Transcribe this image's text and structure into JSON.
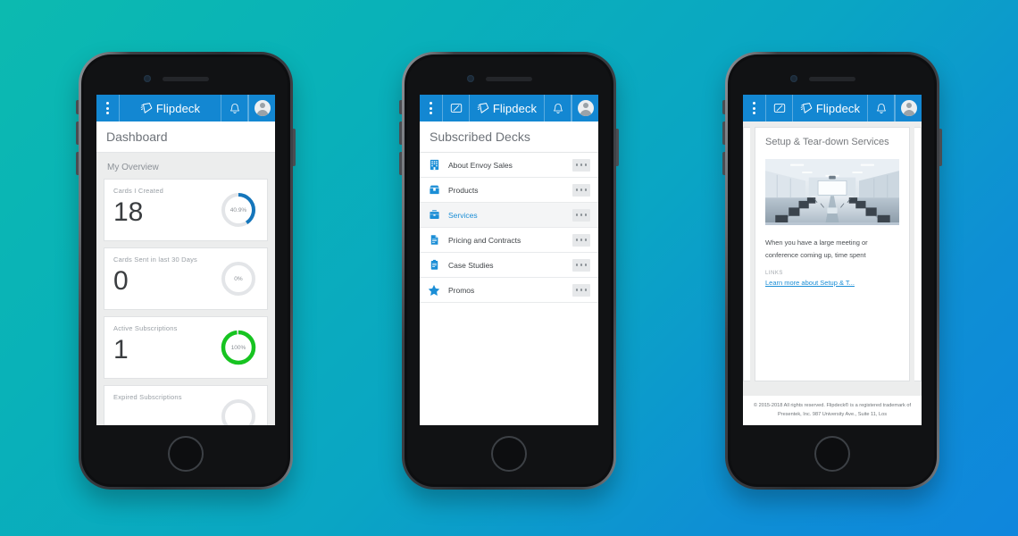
{
  "background": {
    "from": "#0cbab0",
    "to": "#0f86dd"
  },
  "brand": {
    "name": "Flipdeck",
    "accent": "#1387d2",
    "logo_icon": "flipdeck-logo-icon"
  },
  "appbar": {
    "menu_icon": "kebab-menu-icon",
    "card_icon": "create-card-icon",
    "bell_icon": "notification-bell-icon",
    "avatar_icon": "user-avatar-icon"
  },
  "phones": [
    {
      "id": "dashboard",
      "title": "Dashboard",
      "section_label": "My Overview",
      "stats": [
        {
          "title": "Cards I Created",
          "value": "18",
          "percent_label": "40.9%",
          "percent": 40.9,
          "color": "#1576bb"
        },
        {
          "title": "Cards Sent in last 30 Days",
          "value": "0",
          "percent_label": "0%",
          "percent": 0,
          "color": "#d8dade"
        },
        {
          "title": "Active Subscriptions",
          "value": "1",
          "percent_label": "100%",
          "percent": 100,
          "color": "#17c421"
        },
        {
          "title": "Expired Subscriptions",
          "value": "",
          "percent_label": "",
          "percent": 0,
          "color": "#d8dade"
        }
      ]
    },
    {
      "id": "subscribed-decks",
      "title": "Subscribed Decks",
      "more_icon": "more-options-icon",
      "decks": [
        {
          "name": "About Envoy Sales",
          "icon": "building-icon",
          "active": false
        },
        {
          "name": "Products",
          "icon": "box-icon",
          "active": false
        },
        {
          "name": "Services",
          "icon": "briefcase-icon",
          "active": true
        },
        {
          "name": "Pricing and Contracts",
          "icon": "document-icon",
          "active": false
        },
        {
          "name": "Case Studies",
          "icon": "clipboard-icon",
          "active": false
        },
        {
          "name": "Promos",
          "icon": "star-icon",
          "active": false
        }
      ]
    },
    {
      "id": "card-viewer",
      "card": {
        "title": "Setup & Tear-down Services",
        "image_alt": "conference-room-photo",
        "description": "When you have a large meeting or conference coming up, time spent",
        "links_label": "LINKS",
        "link_text": "Learn more about Setup & T..."
      },
      "footer": "© 2015-2018 All rights reserved. Flipdeck® is a registered trademark of Presentek, Inc. 987 University Ave., Suite 11, Los"
    }
  ]
}
